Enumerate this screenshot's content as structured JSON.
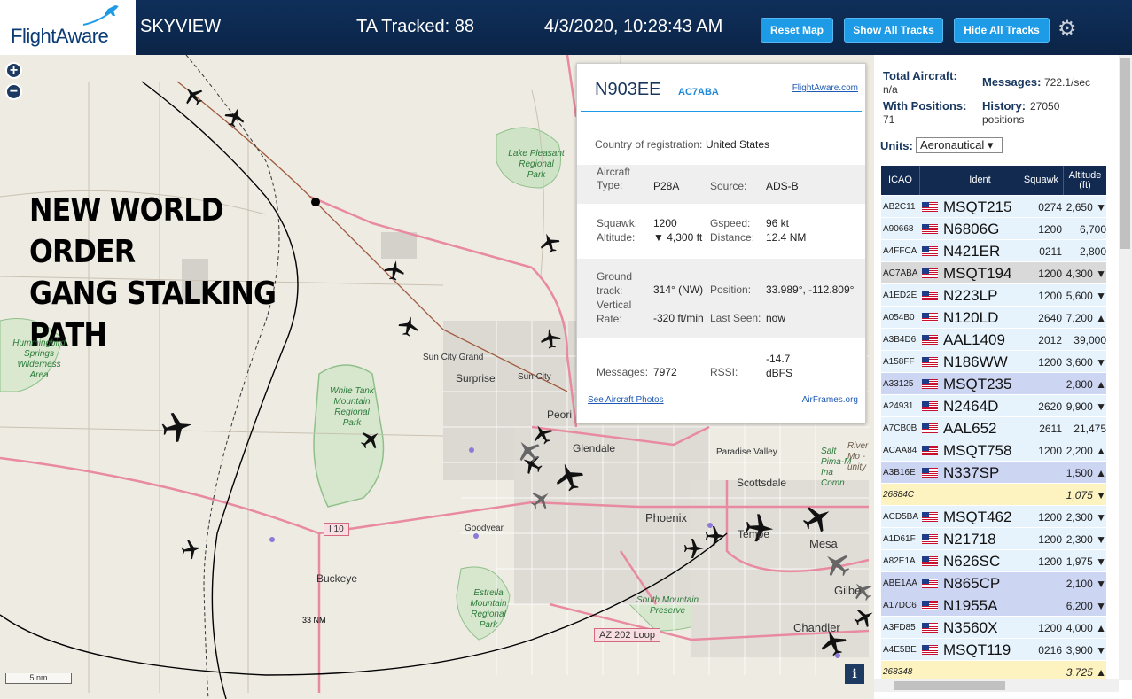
{
  "header": {
    "logo": "FlightAware",
    "title": "SKYVIEW",
    "tracked": "TA Tracked: 88",
    "datetime": "4/3/2020, 10:28:43 AM",
    "buttons": {
      "reset": "Reset Map",
      "show": "Show All Tracks",
      "hide": "Hide All Tracks"
    },
    "gear_icon": "gear-icon"
  },
  "map": {
    "zoom_in": "+",
    "zoom_out": "−",
    "annotation": [
      "NEW WORLD",
      "ORDER",
      "GANG STALKING",
      "PATH"
    ],
    "places": {
      "sun_city_grand": "Sun City Grand",
      "surprise": "Surprise",
      "sun_city": "Sun City",
      "peoria": "Peori",
      "glendale": "Glendale",
      "paradise_valley": "Paradise Valley",
      "scottsdale": "Scottsdale",
      "phoenix": "Phoenix",
      "tempe": "Tempe",
      "mesa": "Mesa",
      "gilbert": "Gilbe",
      "chandler": "Chandler",
      "goodyear": "Goodyear",
      "buckeye": "Buckeye"
    },
    "parks": {
      "lake_pleasant": "Lake Pleasant\nRegional\nPark",
      "hummingbird": "Hummingbird\nSprings\nWilderness\nArea",
      "white_tank": "White Tank\nMountain\nRegional\nPark",
      "estrella": "Estrella\nMountain\nRegional\nPark",
      "south_mountain": "South Mountain\nPreserve",
      "salt_river": "Salt\nPima-M\nIna\nComn"
    },
    "salt_river_extra": "River\nMo -\nunity",
    "shields": {
      "i10": "I 10",
      "az202": "AZ 202 Loop"
    },
    "range_ring": "33 NM",
    "scale": "5 nm",
    "info_button": "i"
  },
  "popup": {
    "registration": "N903EE",
    "icao": "AC7ABA",
    "fa_link": "FlightAware.com",
    "country_label": "Country of registration:",
    "country": "United States",
    "aircraft_type_label": "Aircraft\nType:",
    "aircraft_type": "P28A",
    "source_label": "Source:",
    "source": "ADS-B",
    "squawk_label": "Squawk:",
    "squawk": "1200",
    "altitude_label": "Altitude:",
    "altitude": "▼ 4,300 ft",
    "gspeed_label": "Gspeed:",
    "gspeed": "96 kt",
    "distance_label": "Distance:",
    "distance": "12.4 NM",
    "ground_track_label": "Ground\ntrack:",
    "ground_track": "314° (NW)",
    "position_label": "Position:",
    "position": "33.989°, -112.809°",
    "vrate_label": "Vertical\nRate:",
    "vrate": "-320 ft/min",
    "last_seen_label": "Last Seen:",
    "last_seen": "now",
    "messages_label": "Messages:",
    "messages": "7972",
    "rssi_label": "RSSI:",
    "rssi": "-14.7\ndBFS",
    "photos_link": "See Aircraft Photos",
    "airframes_link": "AirFrames.org"
  },
  "panel": {
    "total_label": "Total Aircraft:",
    "total": "n/a",
    "positions_label": "With Positions:",
    "positions": "71",
    "messages_label": "Messages:",
    "messages": "722.1/sec",
    "history_label": "History:",
    "history": "27050\npositions",
    "units_label": "Units:",
    "units": "Aeronautical ▾",
    "columns": {
      "icao": "ICAO",
      "ident": "Ident",
      "squawk": "Squawk",
      "altitude": "Altitude\n(ft)"
    },
    "rows": [
      {
        "icao": "AB2C11",
        "flag": true,
        "ident": "MSQT215",
        "squawk": "0274",
        "alt": "2,650 ▼",
        "bg": "#e6f3fc"
      },
      {
        "icao": "A90668",
        "flag": true,
        "ident": "N6806G",
        "squawk": "1200",
        "alt": "6,700",
        "bg": "#e6f3fc"
      },
      {
        "icao": "A4FFCA",
        "flag": true,
        "ident": "N421ER",
        "squawk": "0211",
        "alt": "2,800",
        "bg": "#e6f3fc"
      },
      {
        "icao": "AC7ABA",
        "flag": true,
        "ident": "MSQT194",
        "squawk": "1200",
        "alt": "4,300 ▼",
        "bg": "#d9d9d9"
      },
      {
        "icao": "A1ED2E",
        "flag": true,
        "ident": "N223LP",
        "squawk": "1200",
        "alt": "5,600 ▼",
        "bg": "#e6f3fc"
      },
      {
        "icao": "A054B0",
        "flag": true,
        "ident": "N120LD",
        "squawk": "2640",
        "alt": "7,200 ▲",
        "bg": "#e6f3fc"
      },
      {
        "icao": "A3B4D6",
        "flag": true,
        "ident": "AAL1409",
        "squawk": "2012",
        "alt": "39,000",
        "bg": "#e6f3fc"
      },
      {
        "icao": "A158FF",
        "flag": true,
        "ident": "N186WW",
        "squawk": "1200",
        "alt": "3,600 ▼",
        "bg": "#e6f3fc"
      },
      {
        "icao": "A33125",
        "flag": true,
        "ident": "MSQT235",
        "squawk": "",
        "alt": "2,800 ▲",
        "bg": "#ccd5f2"
      },
      {
        "icao": "A24931",
        "flag": true,
        "ident": "N2464D",
        "squawk": "2620",
        "alt": "9,900 ▼",
        "bg": "#e6f3fc"
      },
      {
        "icao": "A7CB0B",
        "flag": true,
        "ident": "AAL652",
        "squawk": "2611",
        "alt": "21,475 ▲",
        "bg": "#e6f3fc"
      },
      {
        "icao": "ACAA84",
        "flag": true,
        "ident": "MSQT758",
        "squawk": "1200",
        "alt": "2,200 ▲",
        "bg": "#e6f3fc"
      },
      {
        "icao": "A3B16E",
        "flag": true,
        "ident": "N337SP",
        "squawk": "",
        "alt": "1,500 ▲",
        "bg": "#ccd5f2"
      },
      {
        "icao": "26884C",
        "flag": false,
        "ident": "",
        "squawk": "",
        "alt": "1,075 ▼",
        "bg": "#fdf3c0",
        "yellow": true
      },
      {
        "icao": "ACD5BA",
        "flag": true,
        "ident": "MSQT462",
        "squawk": "1200",
        "alt": "2,300 ▼",
        "bg": "#e6f3fc"
      },
      {
        "icao": "A1D61F",
        "flag": true,
        "ident": "N21718",
        "squawk": "1200",
        "alt": "2,300 ▼",
        "bg": "#e6f3fc"
      },
      {
        "icao": "A82E1A",
        "flag": true,
        "ident": "N626SC",
        "squawk": "1200",
        "alt": "1,975 ▼",
        "bg": "#e6f3fc"
      },
      {
        "icao": "ABE1AA",
        "flag": true,
        "ident": "N865CP",
        "squawk": "",
        "alt": "2,100 ▼",
        "bg": "#ccd5f2"
      },
      {
        "icao": "A17DC6",
        "flag": true,
        "ident": "N1955A",
        "squawk": "",
        "alt": "6,200 ▼",
        "bg": "#ccd5f2"
      },
      {
        "icao": "A3FD85",
        "flag": true,
        "ident": "N3560X",
        "squawk": "1200",
        "alt": "4,000 ▲",
        "bg": "#e6f3fc"
      },
      {
        "icao": "A4E5BE",
        "flag": true,
        "ident": "MSQT119",
        "squawk": "0216",
        "alt": "3,900 ▼",
        "bg": "#e6f3fc"
      },
      {
        "icao": "268348",
        "flag": false,
        "ident": "",
        "squawk": "",
        "alt": "3,725 ▲",
        "bg": "#fdf3c0",
        "yellow": true
      }
    ]
  }
}
